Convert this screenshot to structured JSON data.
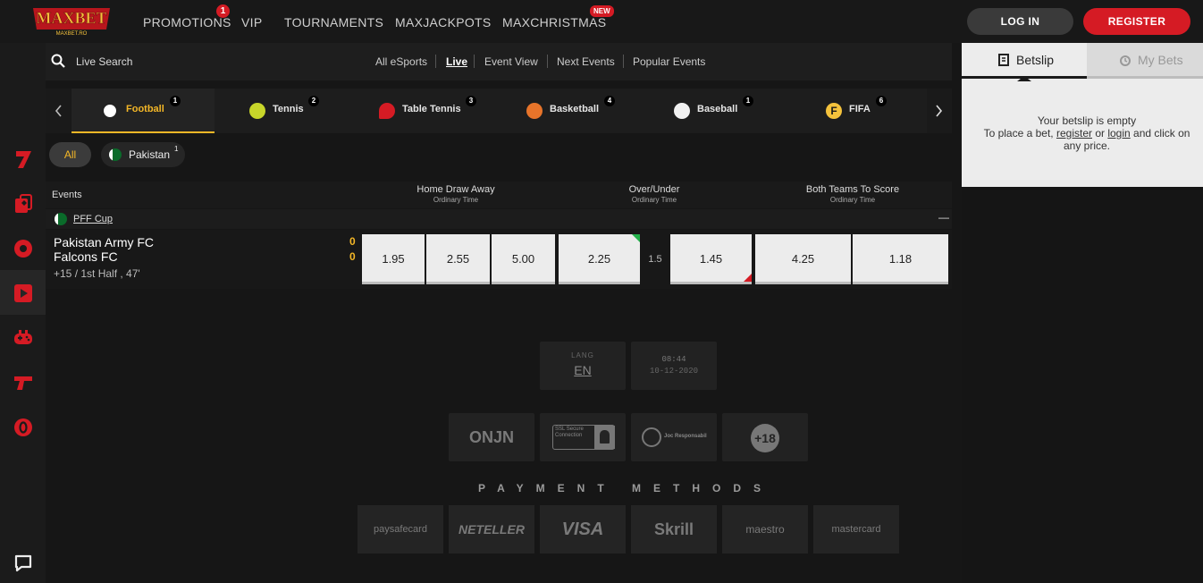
{
  "header": {
    "brand": "MAXBET",
    "brand_sub": "MAXBET.RO",
    "nav": [
      {
        "label": "PROMOTIONS",
        "badge": "1"
      },
      {
        "label": "VIP"
      },
      {
        "label": "TOURNAMENTS"
      },
      {
        "label": "MAXJACKPOTS"
      },
      {
        "label": "MAXCHRISTMAS",
        "badge": "NEW"
      }
    ],
    "login_label": "LOG IN",
    "register_label": "REGISTER"
  },
  "sidebar": {
    "icons": [
      "seven-icon",
      "cards-icon",
      "football-icon",
      "live-play-icon",
      "gamepad-icon",
      "gun-icon",
      "zero-icon",
      "chat-icon"
    ],
    "active_index": 3
  },
  "filter": {
    "search_label": "Live Search",
    "tabs": [
      "All eSports",
      "Live",
      "Event View",
      "Next Events",
      "Popular Events"
    ],
    "active_tab": "Live"
  },
  "sports": [
    {
      "name": "Football",
      "count": "1",
      "active": true
    },
    {
      "name": "Tennis",
      "count": "2"
    },
    {
      "name": "Table Tennis",
      "count": "3"
    },
    {
      "name": "Basketball",
      "count": "4"
    },
    {
      "name": "Baseball",
      "count": "1"
    },
    {
      "name": "FIFA",
      "count": "6"
    }
  ],
  "chips": {
    "all": "All",
    "country": "Pakistan",
    "country_count": "1"
  },
  "table": {
    "events_label": "Events",
    "markets": [
      {
        "name": "Home Draw Away",
        "sub": "Ordinary Time"
      },
      {
        "name": "Over/Under",
        "sub": "Ordinary Time"
      },
      {
        "name": "Both Teams To Score",
        "sub": "Ordinary Time"
      }
    ],
    "collapse": "—"
  },
  "league": {
    "name": "PFF Cup"
  },
  "event": {
    "home": "Pakistan Army FC",
    "away": "Falcons FC",
    "home_score": "0",
    "away_score": "0",
    "info": "+15 / 1st Half , 47'",
    "odds_hda": [
      "1.95",
      "2.55",
      "5.00"
    ],
    "over": "2.25",
    "line": "1.5",
    "under": "1.45",
    "btts": [
      "4.25",
      "1.18"
    ]
  },
  "footer": {
    "lang_label": "LANG",
    "lang_value": "EN",
    "time": "08:44",
    "date": "10-12-2020",
    "badges": [
      "ONJN",
      "SSL Secure Connection",
      "Joc Responsabil",
      "+18"
    ],
    "payment_title": "PAYMENT METHODS",
    "payments": [
      "paysafecard",
      "NETELLER",
      "VISA",
      "Skrill",
      "maestro",
      "mastercard"
    ]
  },
  "betslip": {
    "tab_betslip": "Betslip",
    "tab_mybets": "My Bets",
    "empty_line1": "Your betslip is empty",
    "empty_prefix": "To place a bet,",
    "register_link": "register",
    "or_text": "or",
    "login_link": "login",
    "empty_suffix": "and click on any price."
  },
  "colors": {
    "accent": "#d51b24",
    "highlight": "#f4b727",
    "up": "#23b04a",
    "down": "#d51b24",
    "background": "#151515"
  }
}
